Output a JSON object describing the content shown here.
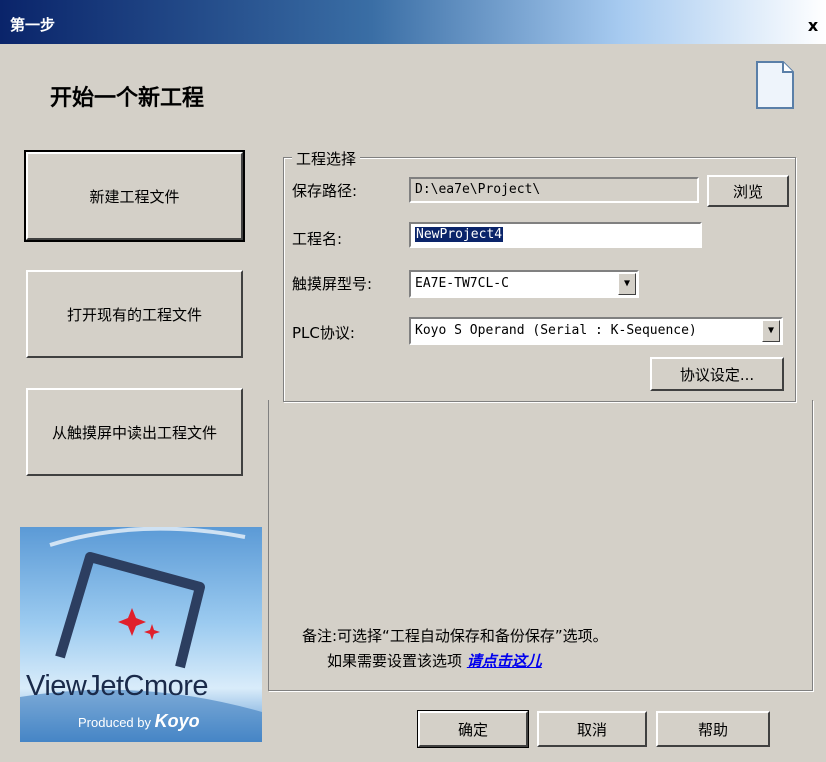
{
  "window": {
    "title": "第一步",
    "close_glyph": "x"
  },
  "heading": "开始一个新工程",
  "icons": {
    "new_doc": "document-icon",
    "close": "close-icon",
    "dropdown": "chevron-down-icon"
  },
  "left_buttons": [
    {
      "label": "新建工程文件",
      "active": true
    },
    {
      "label": "打开现有的工程文件",
      "active": false
    },
    {
      "label": "从触摸屏中读出工程文件",
      "active": false
    }
  ],
  "project": {
    "group_title": "工程选择",
    "save_path_label": "保存路径:",
    "save_path_value": "D:\\ea7e\\Project\\",
    "browse_label": "浏览",
    "name_label": "工程名:",
    "name_value": "NewProject4",
    "model_label": "触摸屏型号:",
    "model_value": "EA7E-TW7CL-C",
    "plc_label": "PLC协议:",
    "plc_value": "Koyo S Operand (Serial : K-Sequence)",
    "protocol_settings_label": "协议设定..."
  },
  "note": {
    "line1": "备注:可选择“工程自动保存和备份保存”选项。",
    "line2_prefix": "如果需要设置该选项",
    "link": "请点击这儿"
  },
  "logo": {
    "name": "ViewJetCmore",
    "produced_by": "Produced by",
    "brand": "Koyo"
  },
  "footer": {
    "ok": "确定",
    "cancel": "取消",
    "help": "帮助"
  },
  "colors": {
    "titlebar": "#0a246a",
    "face": "#d4d0c8",
    "selection": "#0a246a",
    "link": "#0000ee"
  }
}
